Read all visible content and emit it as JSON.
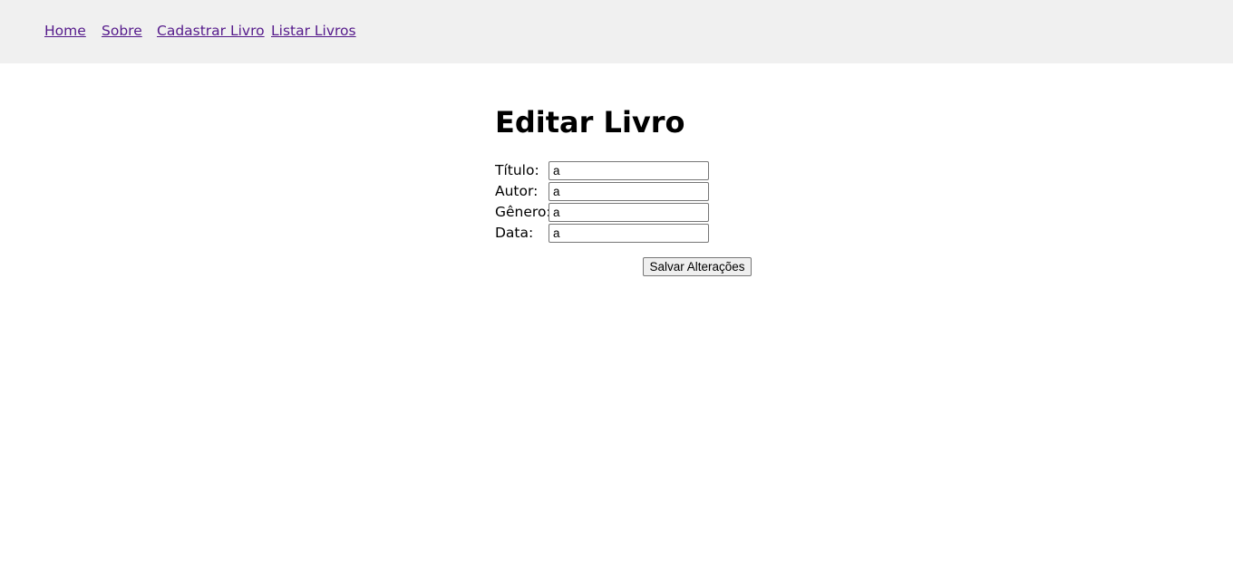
{
  "nav": {
    "items": [
      {
        "label": "Home"
      },
      {
        "label": "Sobre"
      },
      {
        "label": "Cadastrar Livro"
      },
      {
        "label": "Listar Livros"
      }
    ],
    "link_color": "#551a8b",
    "background": "#f0f0f0"
  },
  "page": {
    "title": "Editar Livro"
  },
  "form": {
    "fields": [
      {
        "label": "Título:",
        "value": "a"
      },
      {
        "label": "Autor:",
        "value": "a"
      },
      {
        "label": "Gênero:",
        "value": "a"
      },
      {
        "label": "Data:",
        "value": "a"
      }
    ],
    "submit_label": "Salvar Alterações"
  }
}
